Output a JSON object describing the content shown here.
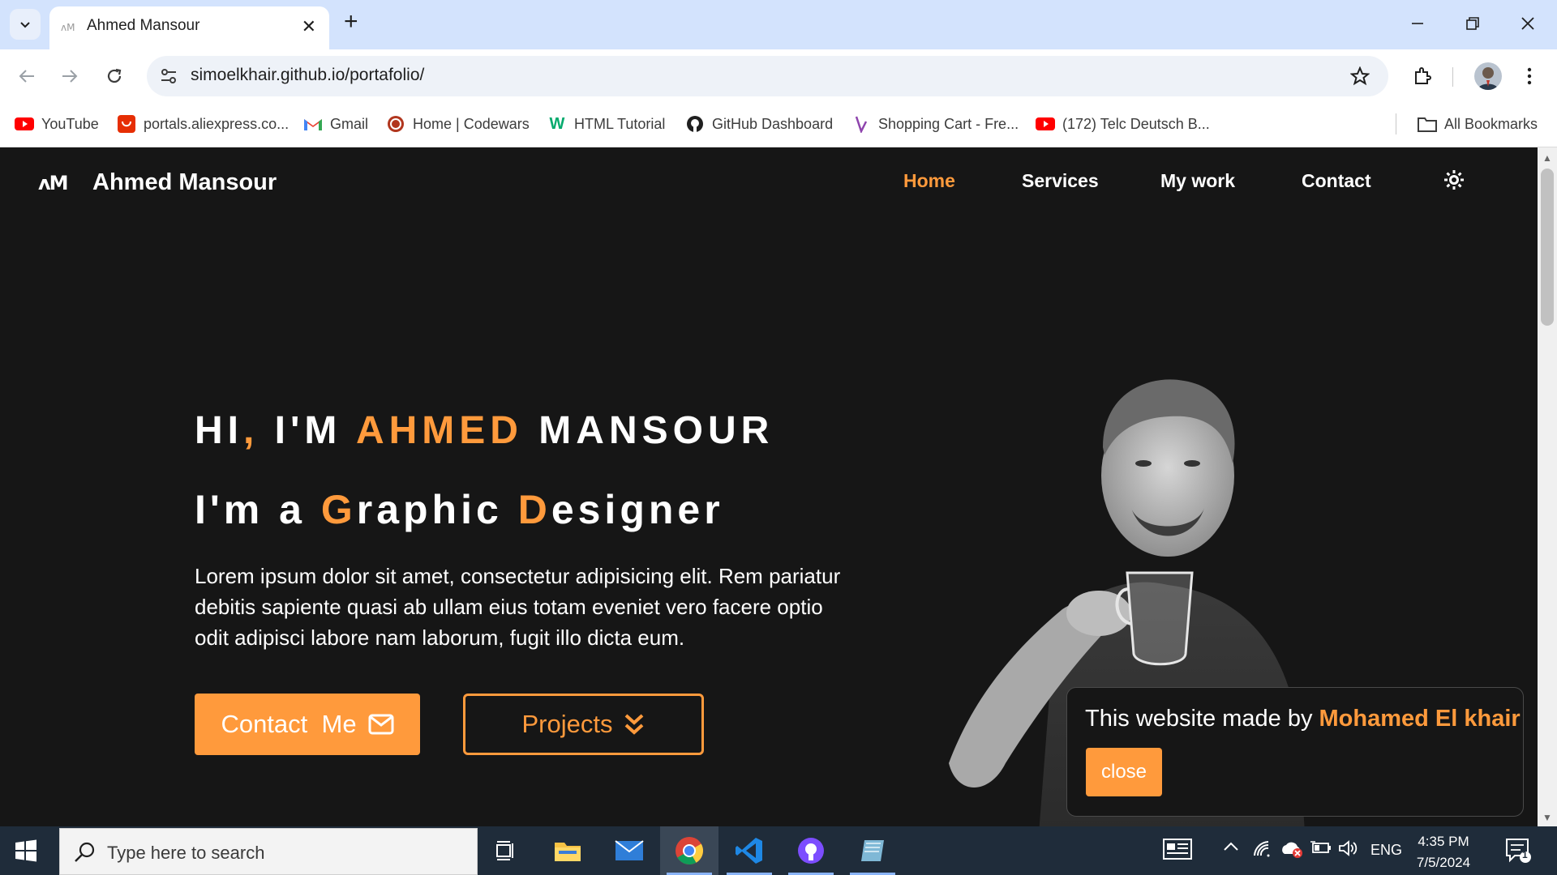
{
  "browser": {
    "tab_title": "Ahmed Mansour",
    "url": "simoelkhair.github.io/portafolio/",
    "bookmarks": [
      {
        "label": "YouTube",
        "icon": "youtube-icon"
      },
      {
        "label": "portals.aliexpress.co...",
        "icon": "aliexpress-icon"
      },
      {
        "label": "Gmail",
        "icon": "gmail-icon"
      },
      {
        "label": "Home | Codewars",
        "icon": "codewars-icon"
      },
      {
        "label": "HTML Tutorial",
        "icon": "w3schools-icon"
      },
      {
        "label": "GitHub Dashboard",
        "icon": "github-icon"
      },
      {
        "label": "Shopping Cart - Fre...",
        "icon": "shopping-cart-icon"
      },
      {
        "label": "(172) Telc Deutsch B...",
        "icon": "youtube-icon"
      }
    ],
    "all_bookmarks": "All Bookmarks"
  },
  "site": {
    "logo_mark": "ʌM",
    "logo_name": "Ahmed Mansour",
    "nav": [
      {
        "label": "Home",
        "active": true
      },
      {
        "label": "Services",
        "active": false
      },
      {
        "label": "My work",
        "active": false
      },
      {
        "label": "Contact",
        "active": false
      }
    ],
    "hero": {
      "hi_1": "HI",
      "hi_comma": ",",
      "hi_2": " I'M ",
      "hi_name_first": "AHMED",
      "hi_name_last": " MANSOUR",
      "role_1": "I'm a ",
      "role_g": "G",
      "role_2": "raphic ",
      "role_d": "D",
      "role_3": "esigner",
      "description": "Lorem ipsum dolor sit amet, consectetur adipisicing elit. Rem pariatur debitis sapiente quasi ab ullam eius totam eveniet vero facere optio odit adipisci labore nam laborum, fugit illo dicta eum.",
      "contact_button": "Contact  Me",
      "projects_button": "Projects"
    },
    "credit_popup": {
      "text": "This website made by ",
      "author": "Mohamed El khair",
      "close_label": "close"
    }
  },
  "taskbar": {
    "search_placeholder": "Type here to search",
    "language": "ENG",
    "time": "4:35 PM",
    "date": "7/5/2024",
    "notification_count": "1"
  },
  "colors": {
    "accent": "#ff9a3c",
    "page_bg": "#161616",
    "tabstrip_bg": "#d3e3fd"
  }
}
